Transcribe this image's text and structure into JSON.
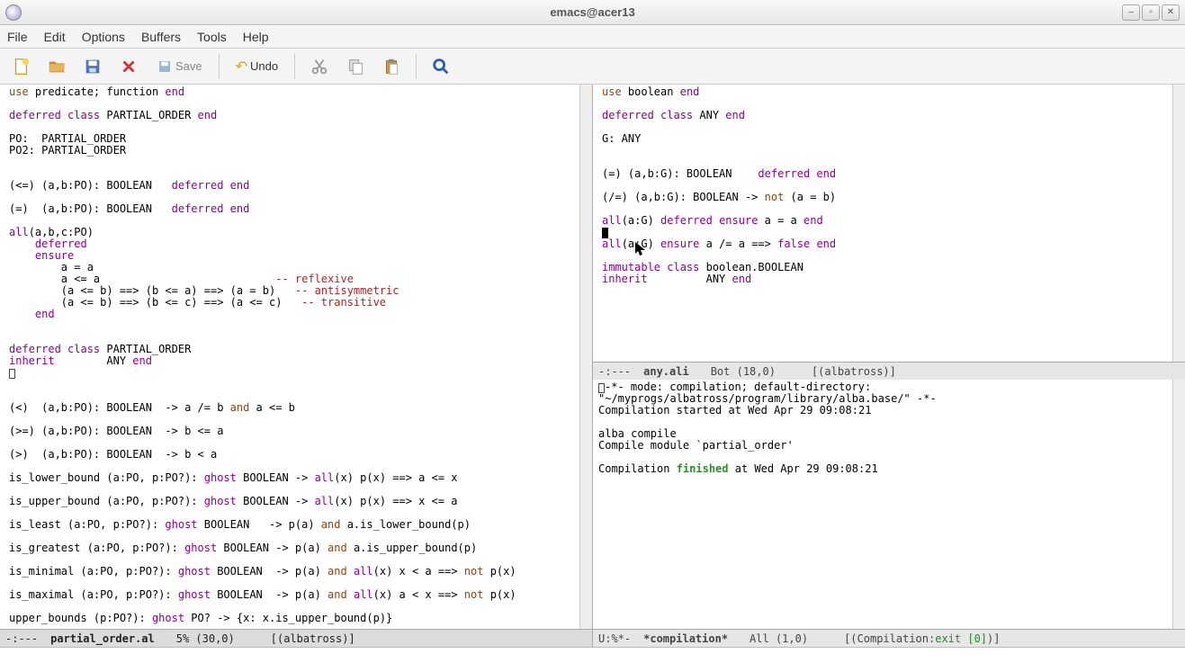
{
  "titlebar": {
    "title": "emacs@acer13"
  },
  "menubar": {
    "file": "File",
    "edit": "Edit",
    "options": "Options",
    "buffers": "Buffers",
    "tools": "Tools",
    "help": "Help"
  },
  "toolbar": {
    "save": "Save",
    "undo": "Undo"
  },
  "left": {
    "modeline": {
      "prefix": "-:---",
      "buffer": "partial_order.al",
      "pos": "5%  (30,0)",
      "mode": "[(albatross)]"
    },
    "code": {
      "l1a": "use",
      "l1b": " predicate; function ",
      "l1c": "end",
      "l2a": "deferred class",
      "l2b": " PARTIAL_ORDER ",
      "l2c": "end",
      "l3": "PO:  PARTIAL_ORDER",
      "l4": "PO2: PARTIAL_ORDER",
      "l5a": "(<=) (a,b:PO): BOOLEAN   ",
      "l5b": "deferred end",
      "l6a": "(=)  (a,b:PO): BOOLEAN   ",
      "l6b": "deferred end",
      "l7a": "all",
      "l7b": "(a,b,c:PO)",
      "l8": "deferred",
      "l9": "ensure",
      "l10": "        a = a",
      "l11a": "        a <= a                           ",
      "l11b": "-- reflexive",
      "l12a": "        (a <= b) ==> (b <= a) ==> (a = b)   ",
      "l12b": "-- antisymmetric",
      "l13a": "        (a <= b) ==> (b <= c) ==> (a <= c)   ",
      "l13b": "-- transitive",
      "l14": "end",
      "l15a": "deferred class",
      "l15b": " PARTIAL_ORDER",
      "l16a": "inherit",
      "l16b": "        ANY ",
      "l16c": "end",
      "l17a": "(<)  (a,b:PO): BOOLEAN  -> a /= b ",
      "l17b": "and",
      "l17c": " a <= b",
      "l18": "(>=) (a,b:PO): BOOLEAN  -> b <= a",
      "l19": "(>)  (a,b:PO): BOOLEAN  -> b < a",
      "l20a": "is_lower_bound (a:PO, p:PO?): ",
      "l20b": "ghost",
      "l20c": " BOOLEAN -> ",
      "l20d": "all",
      "l20e": "(x) p(x) ==> a <= x",
      "l21a": "is_upper_bound (a:PO, p:PO?): ",
      "l21b": "ghost",
      "l21c": " BOOLEAN -> ",
      "l21d": "all",
      "l21e": "(x) p(x) ==> x <= a",
      "l22a": "is_least (a:PO, p:PO?): ",
      "l22b": "ghost",
      "l22c": " BOOLEAN   -> p(a) ",
      "l22d": "and",
      "l22e": " a.is_lower_bound(p)",
      "l23a": "is_greatest (a:PO, p:PO?): ",
      "l23b": "ghost",
      "l23c": " BOOLEAN -> p(a) ",
      "l23d": "and",
      "l23e": " a.is_upper_bound(p)",
      "l24a": "is_minimal (a:PO, p:PO?): ",
      "l24b": "ghost",
      "l24c": " BOOLEAN  -> p(a) ",
      "l24d": "and",
      "l24e": " ",
      "l24f": "all",
      "l24g": "(x) x < a ==> ",
      "l24h": "not",
      "l24i": " p(x)",
      "l25a": "is_maximal (a:PO, p:PO?): ",
      "l25b": "ghost",
      "l25c": " BOOLEAN  -> p(a) ",
      "l25d": "and",
      "l25e": " ",
      "l25f": "all",
      "l25g": "(x) a < x ==> ",
      "l25h": "not",
      "l25i": " p(x)",
      "l26a": "upper_bounds (p:PO?): ",
      "l26b": "ghost",
      "l26c": " PO? -> {x: x.is_upper_bound(p)}"
    }
  },
  "right_top": {
    "modeline": {
      "prefix": "-:---",
      "buffer": "any.ali",
      "pos": "Bot (18,0)",
      "mode": "[(albatross)]"
    },
    "code": {
      "r1a": "use",
      "r1b": " boolean ",
      "r1c": "end",
      "r2a": "deferred class",
      "r2b": " ANY ",
      "r2c": "end",
      "r3": "G: ANY",
      "r4a": "(=) (a,b:G): BOOLEAN    ",
      "r4b": "deferred end",
      "r5a": "(/=) (a,b:G): BOOLEAN -> ",
      "r5b": "not",
      "r5c": " (a = b)",
      "r6a": "all",
      "r6b": "(a:G) ",
      "r6c": "deferred ensure",
      "r6d": " a = a ",
      "r6e": "end",
      "r7a": "all",
      "r7b": "(a:G) ",
      "r7c": "ensure",
      "r7d": " a /= a ==> ",
      "r7e": "false end",
      "r8a": "immutable class",
      "r8b": " boolean.BOOLEAN",
      "r9a": "inherit",
      "r9b": "         ANY ",
      "r9c": "end"
    }
  },
  "right_bot": {
    "modeline": {
      "prefix": "U:%*-",
      "buffer": "*compilation*",
      "pos": "All (1,0)",
      "mode_pre": "[(Compilation:",
      "mode_exit": "exit [0]",
      "mode_post": ")]"
    },
    "compile": {
      "c1": "-*- mode: compilation; default-directory: \"~/myprogs/albatross/program/library/alba.base/\" -*-",
      "c2": "Compilation started at Wed Apr 29 09:08:21",
      "c3": "alba compile",
      "c4": "Compile module `partial_order'",
      "c5a": "Compilation ",
      "c5b": "finished",
      "c5c": " at Wed Apr 29 09:08:21"
    }
  }
}
